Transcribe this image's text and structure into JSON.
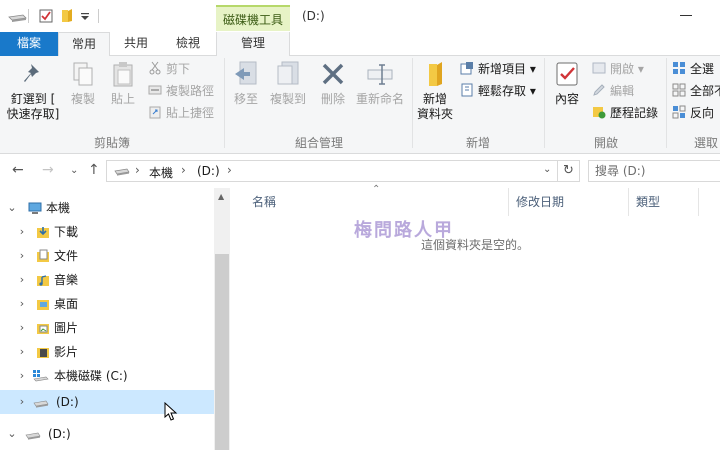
{
  "titlebar": {
    "contextual_tab_group": "磁碟機工具",
    "window_title": "(D:)"
  },
  "tabs": {
    "file": "檔案",
    "home": "常用",
    "share": "共用",
    "view": "檢視",
    "manage": "管理"
  },
  "ribbon": {
    "clipboard": {
      "label": "剪貼簿",
      "pin_quick_access": [
        "釘選到 [",
        "快速存取]"
      ],
      "copy": "複製",
      "paste": "貼上",
      "cut": "剪下",
      "copy_path": "複製路徑",
      "paste_shortcut": "貼上捷徑"
    },
    "organize": {
      "label": "組合管理",
      "move_to": "移至",
      "copy_to": "複製到",
      "delete": "刪除",
      "rename": "重新命名"
    },
    "new": {
      "label": "新增",
      "new_folder": [
        "新增",
        "資料夾"
      ],
      "new_item": "新增項目",
      "easy_access": "輕鬆存取"
    },
    "open": {
      "label": "開啟",
      "properties": "內容",
      "open": "開啟",
      "edit": "編輯",
      "history": "歷程記錄"
    },
    "select": {
      "label": "選取",
      "select_all": "全選",
      "select_none": "全部不",
      "invert": "反向"
    }
  },
  "address": {
    "crumb_1": "本機",
    "crumb_2": "(D:)",
    "search_placeholder": "搜尋 (D:)"
  },
  "nav": {
    "this_pc": "本機",
    "downloads": "下載",
    "documents": "文件",
    "music": "音樂",
    "desktop": "桌面",
    "pictures": "圖片",
    "videos": "影片",
    "local_disk_c": "本機磁碟 (C:)",
    "drive_d": "(D:)",
    "drive_d_root": "(D:)"
  },
  "content": {
    "col_name": "名稱",
    "col_modified": "修改日期",
    "col_type": "類型",
    "empty_message": "這個資料夾是空的。"
  },
  "watermark": "梅問路人甲",
  "colors": {
    "accent": "#1979ca",
    "selection": "#cce8ff",
    "contextual": "#e7f3c6"
  }
}
